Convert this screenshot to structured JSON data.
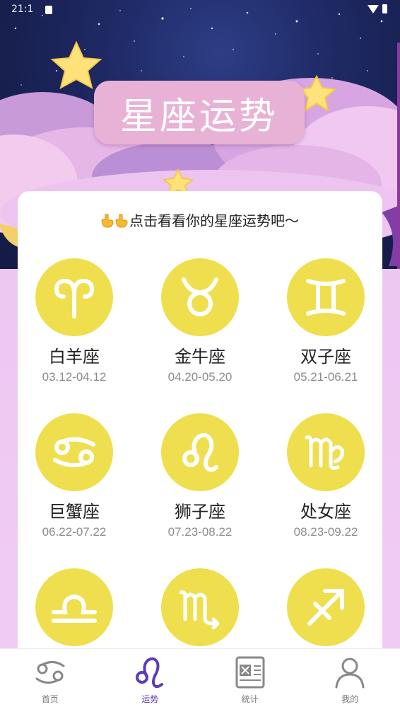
{
  "status_bar": {
    "time": "21:1"
  },
  "header": {
    "title": "星座运势"
  },
  "card": {
    "hint_text": "点击看看你的星座运势吧～",
    "signs": [
      {
        "name": "白羊座",
        "dates": "03.12-04.12",
        "icon": "aries-icon"
      },
      {
        "name": "金牛座",
        "dates": "04.20-05.20",
        "icon": "taurus-icon"
      },
      {
        "name": "双子座",
        "dates": "05.21-06.21",
        "icon": "gemini-icon"
      },
      {
        "name": "巨蟹座",
        "dates": "06.22-07.22",
        "icon": "cancer-icon"
      },
      {
        "name": "狮子座",
        "dates": "07.23-08.22",
        "icon": "leo-icon"
      },
      {
        "name": "处女座",
        "dates": "08.23-09.22",
        "icon": "virgo-icon"
      },
      {
        "name": "",
        "dates": "",
        "icon": "libra-icon"
      },
      {
        "name": "",
        "dates": "",
        "icon": "scorpio-icon"
      },
      {
        "name": "",
        "dates": "",
        "icon": "sagittarius-icon"
      }
    ]
  },
  "bottom_nav": {
    "items": [
      {
        "label": "首页",
        "icon": "cancer-nav-icon",
        "active": false
      },
      {
        "label": "运势",
        "icon": "leo-nav-icon",
        "active": true
      },
      {
        "label": "统计",
        "icon": "spreadsheet-icon",
        "active": false
      },
      {
        "label": "我的",
        "icon": "person-icon",
        "active": false
      }
    ]
  },
  "colors": {
    "accent": "#5b3cb8",
    "sign_circle": "#efdf4e",
    "title_pill": "#e8b2d6",
    "page_bg": "#efc9f2"
  }
}
